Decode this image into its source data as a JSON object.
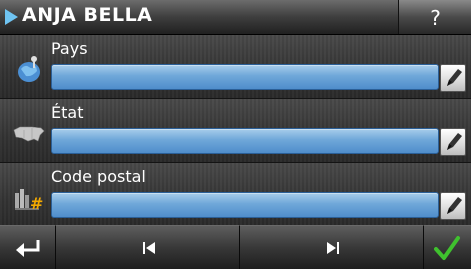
{
  "header": {
    "title": "ANJA BELLA",
    "help_label": "?"
  },
  "rows": [
    {
      "label": "Pays",
      "value": "",
      "icon": "globe-pin-icon"
    },
    {
      "label": "État",
      "value": "",
      "icon": "map-usa-icon"
    },
    {
      "label": "Code postal",
      "value": "",
      "icon": "zip-code-icon"
    }
  ],
  "footer": {
    "back_icon": "back-arrow-icon",
    "prev_icon": "skip-previous-icon",
    "next_icon": "skip-next-icon",
    "ok_icon": "checkmark-icon"
  },
  "colors": {
    "accent": "#6fc4f2",
    "field": "#5b97d0",
    "ok": "#3fc12e"
  }
}
